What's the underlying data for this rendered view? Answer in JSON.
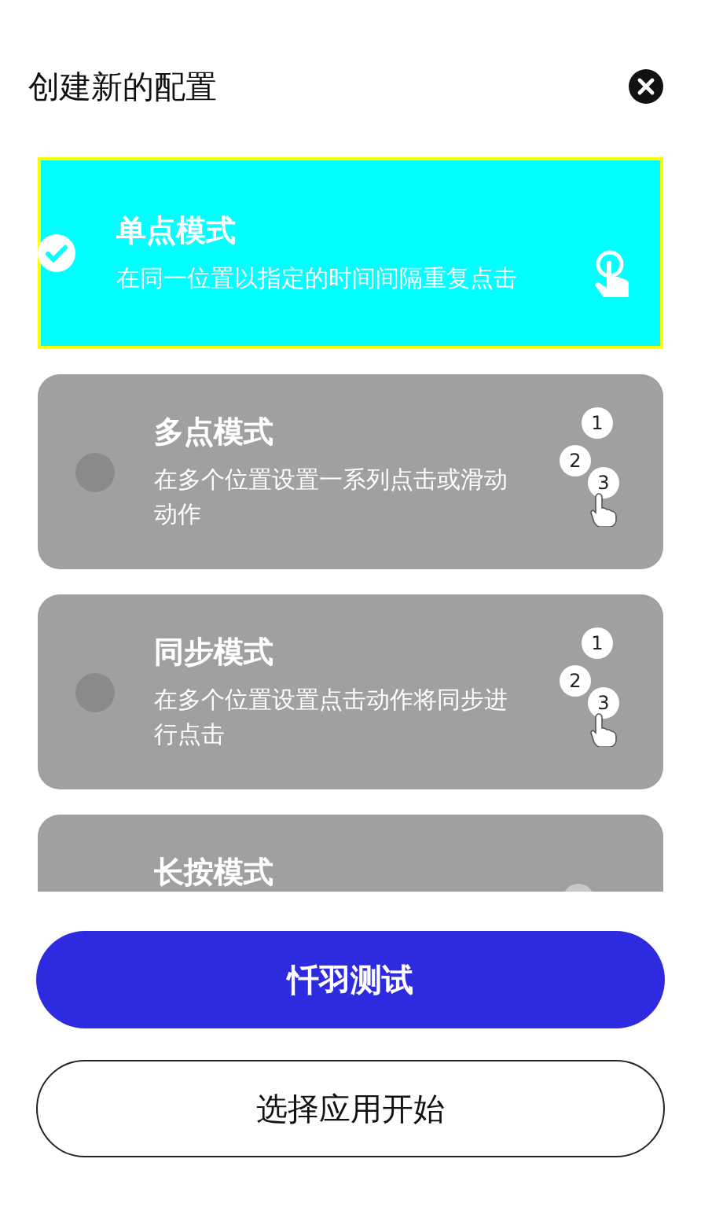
{
  "dialog": {
    "title": "创建新的配置"
  },
  "modes": [
    {
      "title": "单点模式",
      "description": "在同一位置以指定的时间间隔重复点击",
      "selected": true,
      "kind": "single"
    },
    {
      "title": "多点模式",
      "description": "在多个位置设置一系列点击或滑动动作",
      "selected": false,
      "kind": "multi",
      "steps": [
        "1",
        "2",
        "3"
      ]
    },
    {
      "title": "同步模式",
      "description": "在多个位置设置点击动作将同步进行点击",
      "selected": false,
      "kind": "multi",
      "steps": [
        "1",
        "2",
        "3"
      ]
    },
    {
      "title": "长按模式",
      "selected": false,
      "kind": "press"
    }
  ],
  "buttons": [
    {
      "label": "忏羽测试",
      "kind": "primary"
    },
    {
      "label": "选择应用开始",
      "kind": "outline"
    }
  ]
}
